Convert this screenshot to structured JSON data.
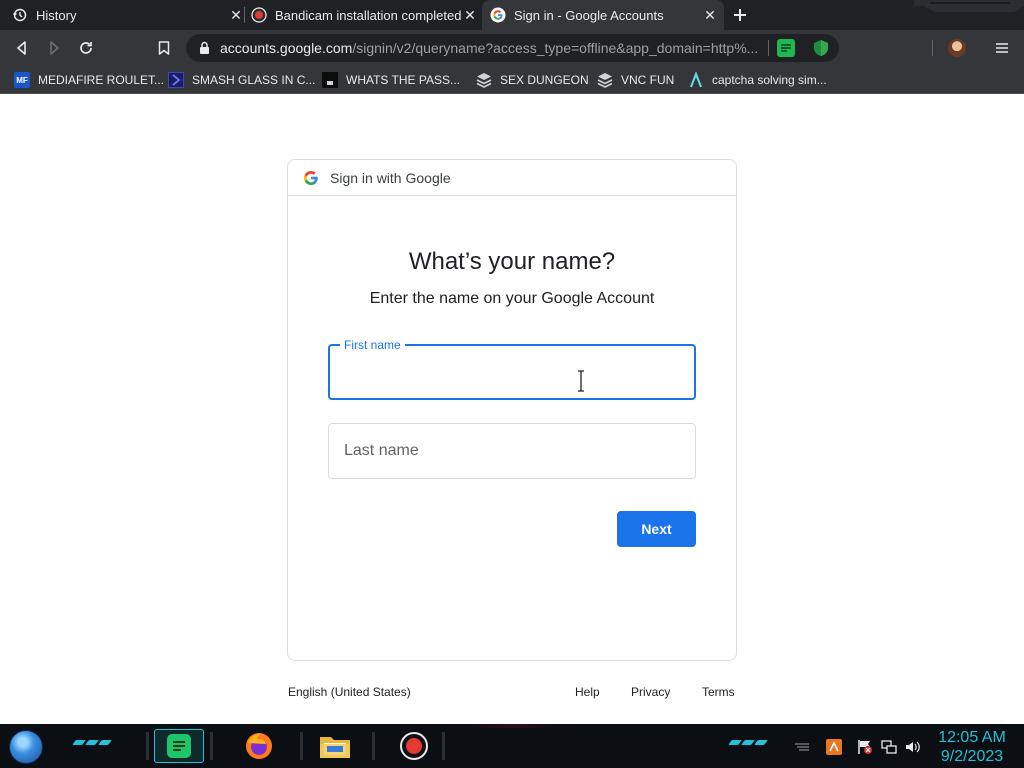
{
  "browser": {
    "tabs": [
      {
        "title": "History",
        "icon": "history-icon"
      },
      {
        "title": "Bandicam installation completed s",
        "icon": "bandicam-icon"
      },
      {
        "title": "Sign in - Google Accounts",
        "icon": "google-icon",
        "active": true
      }
    ],
    "url": {
      "host": "accounts.google.com",
      "path": "/signin/v2/queryname?access_type=offline&app_domain=http%..."
    },
    "bookmarks": [
      {
        "label": "MEDIAFIRE ROULET...",
        "icon": "mediafire-icon",
        "icon_text": "MF"
      },
      {
        "label": "SMASH GLASS IN C...",
        "icon": "chevron-bookmark-icon",
        "icon_text": ""
      },
      {
        "label": "WHATS THE PASS...",
        "icon": "dark-site-icon",
        "icon_text": ""
      },
      {
        "label": "SEX DUNGEON",
        "icon": "stack-icon",
        "icon_text": ""
      },
      {
        "label": "VNC FUN",
        "icon": "stack-icon",
        "icon_text": ""
      },
      {
        "label": "captcha solving sim...",
        "icon": "lambda-icon",
        "icon_text": ""
      }
    ]
  },
  "signin": {
    "header": "Sign in with Google",
    "heading": "What’s your name?",
    "subheading": "Enter the name on your Google Account",
    "first_name_label": "First name",
    "first_name_value": "",
    "last_name_placeholder": "Last name",
    "next_label": "Next"
  },
  "footer": {
    "language": "English (United States)",
    "help": "Help",
    "privacy": "Privacy",
    "terms": "Terms"
  },
  "taskbar": {
    "time": "12:05 AM",
    "date": "9/2/2023"
  },
  "colors": {
    "accent": "#1a73e8",
    "chrome_dark": "#202124",
    "chrome_toolbar": "#35363a",
    "taskbar_accent": "#1fc2d6"
  }
}
